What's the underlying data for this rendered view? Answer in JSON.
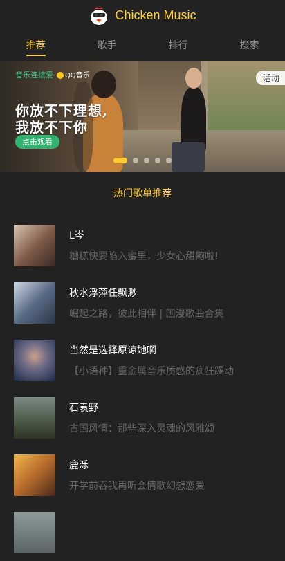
{
  "header": {
    "title": "Chicken Music"
  },
  "tabs": [
    {
      "label": "推荐",
      "active": true
    },
    {
      "label": "歌手",
      "active": false
    },
    {
      "label": "排行",
      "active": false
    },
    {
      "label": "搜索",
      "active": false
    }
  ],
  "banner": {
    "brand": "音乐连接爱",
    "partner": "QQ音乐",
    "line1": "你放不下理想,",
    "line2": "我放不下你",
    "cta": "点击观看",
    "tag": "活动",
    "slide_count": 5,
    "active_slide": 0
  },
  "section": {
    "title": "热门歌单推荐"
  },
  "songs": [
    {
      "name": "L岑",
      "desc": "糟糕快要陷入蜜里，少女心甜齁啦!"
    },
    {
      "name": "秋水浮萍任飘渺",
      "desc": "崛起之路，彼此相伴 | 国漫歌曲合集"
    },
    {
      "name": "当然是选择原谅她啊",
      "desc": "【小语种】重金属音乐质感的疯狂躁动"
    },
    {
      "name": "石袁野",
      "desc": "古国风情：那些深入灵魂的风雅颂"
    },
    {
      "name": "鹿泺",
      "desc": "开学前吞我再听会情歌幻想恋爱"
    }
  ],
  "colors": {
    "accent": "#ffcd32",
    "background": "#222222",
    "cta": "#31b36f"
  }
}
